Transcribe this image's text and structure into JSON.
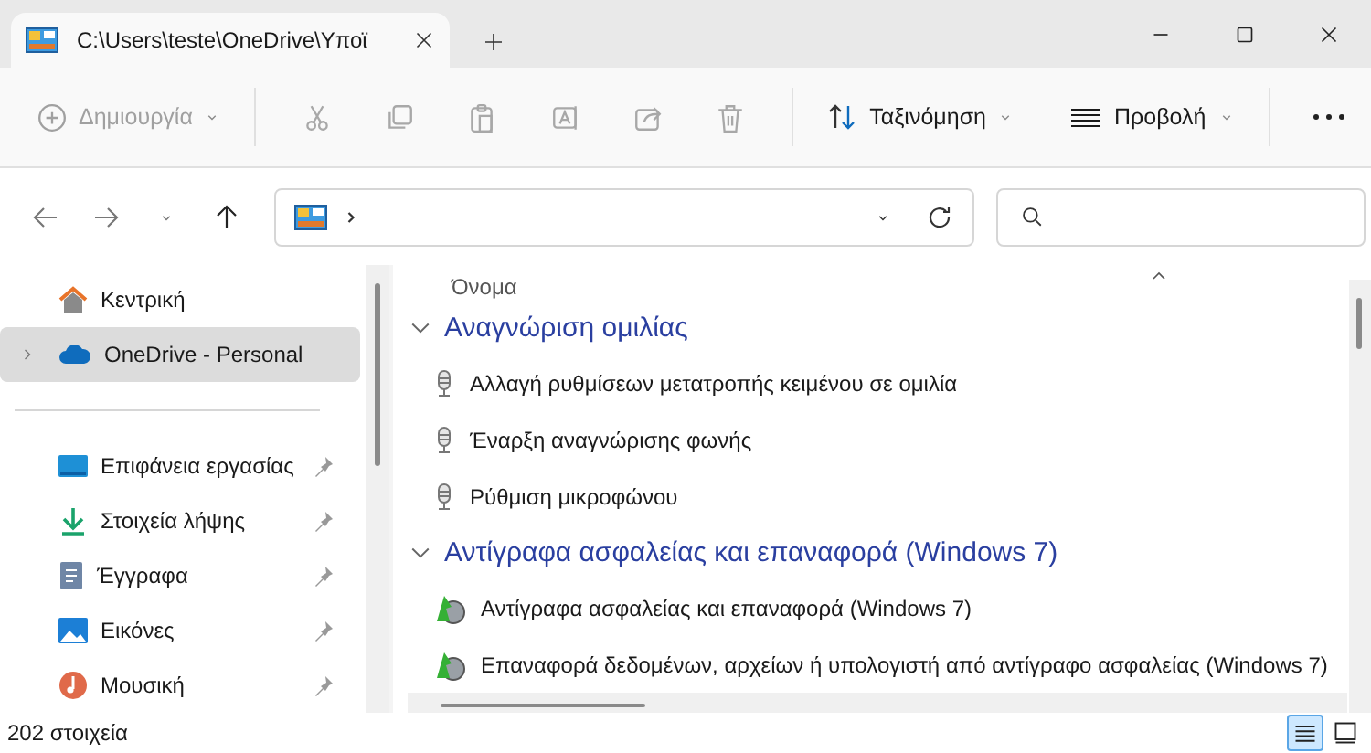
{
  "window": {
    "tab_title": "C:\\Users\\teste\\OneDrive\\Υποϊ"
  },
  "toolbar": {
    "new_button": {
      "label": "Δημιουργία",
      "disabled": true
    },
    "actions": [
      {
        "kind": "cut",
        "disabled": true
      },
      {
        "kind": "copy",
        "disabled": true
      },
      {
        "kind": "paste",
        "disabled": true
      },
      {
        "kind": "rename",
        "disabled": true
      },
      {
        "kind": "share",
        "disabled": true
      },
      {
        "kind": "delete",
        "disabled": true
      }
    ],
    "sort_button": {
      "label": "Ταξινόμηση"
    },
    "view_button": {
      "label": "Προβολή"
    }
  },
  "sidebar": {
    "items": [
      {
        "kind": "home",
        "label": "Κεντρική",
        "selected": false,
        "pinned": false
      },
      {
        "kind": "cloud",
        "label": "OneDrive - Personal",
        "selected": true,
        "pinned": false
      },
      {
        "kind": "desktop",
        "label": "Επιφάνεια εργασίας",
        "selected": false,
        "pinned": true
      },
      {
        "kind": "download",
        "label": "Στοιχεία λήψης",
        "selected": false,
        "pinned": true
      },
      {
        "kind": "documents",
        "label": "Έγγραφα",
        "selected": false,
        "pinned": true
      },
      {
        "kind": "pictures",
        "label": "Εικόνες",
        "selected": false,
        "pinned": true
      },
      {
        "kind": "music",
        "label": "Μουσική",
        "selected": false,
        "pinned": true
      }
    ]
  },
  "content": {
    "column": "Όνομα",
    "groups": [
      {
        "title": "Αναγνώριση ομιλίας",
        "expanded": true,
        "items": [
          {
            "kind": "mic",
            "label": "Αλλαγή ρυθμίσεων μετατροπής κειμένου σε ομιλία"
          },
          {
            "kind": "mic",
            "label": "Έναρξη αναγνώρισης φωνής"
          },
          {
            "kind": "mic",
            "label": "Ρύθμιση μικροφώνου"
          }
        ]
      },
      {
        "title": "Αντίγραφα ασφαλείας και επαναφορά (Windows 7)",
        "expanded": true,
        "items": [
          {
            "kind": "backup",
            "label": "Αντίγραφα ασφαλείας και επαναφορά (Windows 7)"
          },
          {
            "kind": "backup",
            "label": "Επαναφορά δεδομένων, αρχείων ή υπολογιστή από αντίγραφο ασφαλείας (Windows 7)"
          }
        ]
      }
    ]
  },
  "status_bar": {
    "count": "202 στοιχεία",
    "views": [
      {
        "kind": "details",
        "selected": true
      },
      {
        "kind": "tiles",
        "selected": false
      }
    ]
  }
}
